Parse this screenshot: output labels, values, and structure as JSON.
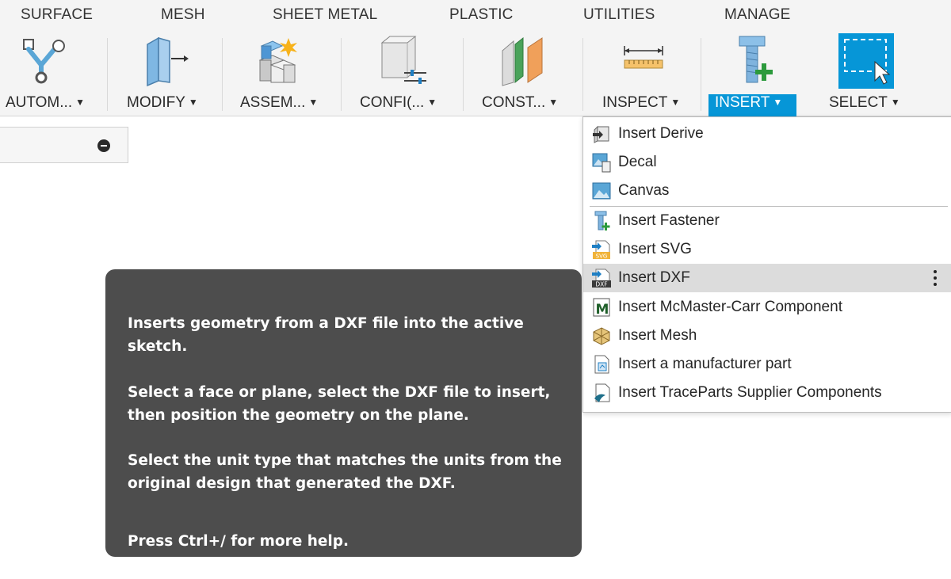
{
  "tabs": [
    "SURFACE",
    "MESH",
    "SHEET METAL",
    "PLASTIC",
    "UTILITIES",
    "MANAGE"
  ],
  "groups": [
    {
      "label": "AUTOM...",
      "icon": "automate-icon"
    },
    {
      "label": "MODIFY",
      "icon": "modify-icon"
    },
    {
      "label": "ASSEM...",
      "icon": "assemble-icon"
    },
    {
      "label": "CONFI(...",
      "icon": "configure-icon"
    },
    {
      "label": "CONST...",
      "icon": "construct-icon"
    },
    {
      "label": "INSPECT",
      "icon": "inspect-measure-icon"
    },
    {
      "label": "INSERT",
      "icon": "insert-fastener-icon"
    },
    {
      "label": "SELECT",
      "icon": "select-window-icon"
    }
  ],
  "caret": "▼",
  "insert_menu": {
    "items": [
      {
        "label": "Insert Derive",
        "icon": "insert-derive-icon"
      },
      {
        "label": "Decal",
        "icon": "decal-icon"
      },
      {
        "label": "Canvas",
        "icon": "canvas-icon"
      },
      {
        "label": "Insert Fastener",
        "icon": "fastener-icon"
      },
      {
        "label": "Insert SVG",
        "icon": "svg-file-icon"
      },
      {
        "label": "Insert DXF",
        "icon": "dxf-file-icon",
        "highlighted": true
      },
      {
        "label": "Insert McMaster-Carr Component",
        "icon": "mcmaster-icon"
      },
      {
        "label": "Insert Mesh",
        "icon": "mesh-icon"
      },
      {
        "label": "Insert a manufacturer part",
        "icon": "manufacturer-part-icon"
      },
      {
        "label": "Insert TraceParts Supplier Components",
        "icon": "traceparts-icon"
      }
    ]
  },
  "tooltip": {
    "line1": "Inserts geometry from a DXF file into the active",
    "line2": "sketch.",
    "line3": "Select a face or plane, select the DXF file to insert,",
    "line4": "then position the geometry on the plane.",
    "line5": "Select the unit type that matches the units from the",
    "line6": "original design that generated the DXF.",
    "line7": "Press Ctrl+/ for more help."
  },
  "colors": {
    "accent": "#0696d7",
    "tooltip_bg": "#4d4d4d",
    "highlight": "#dcdcdc"
  }
}
